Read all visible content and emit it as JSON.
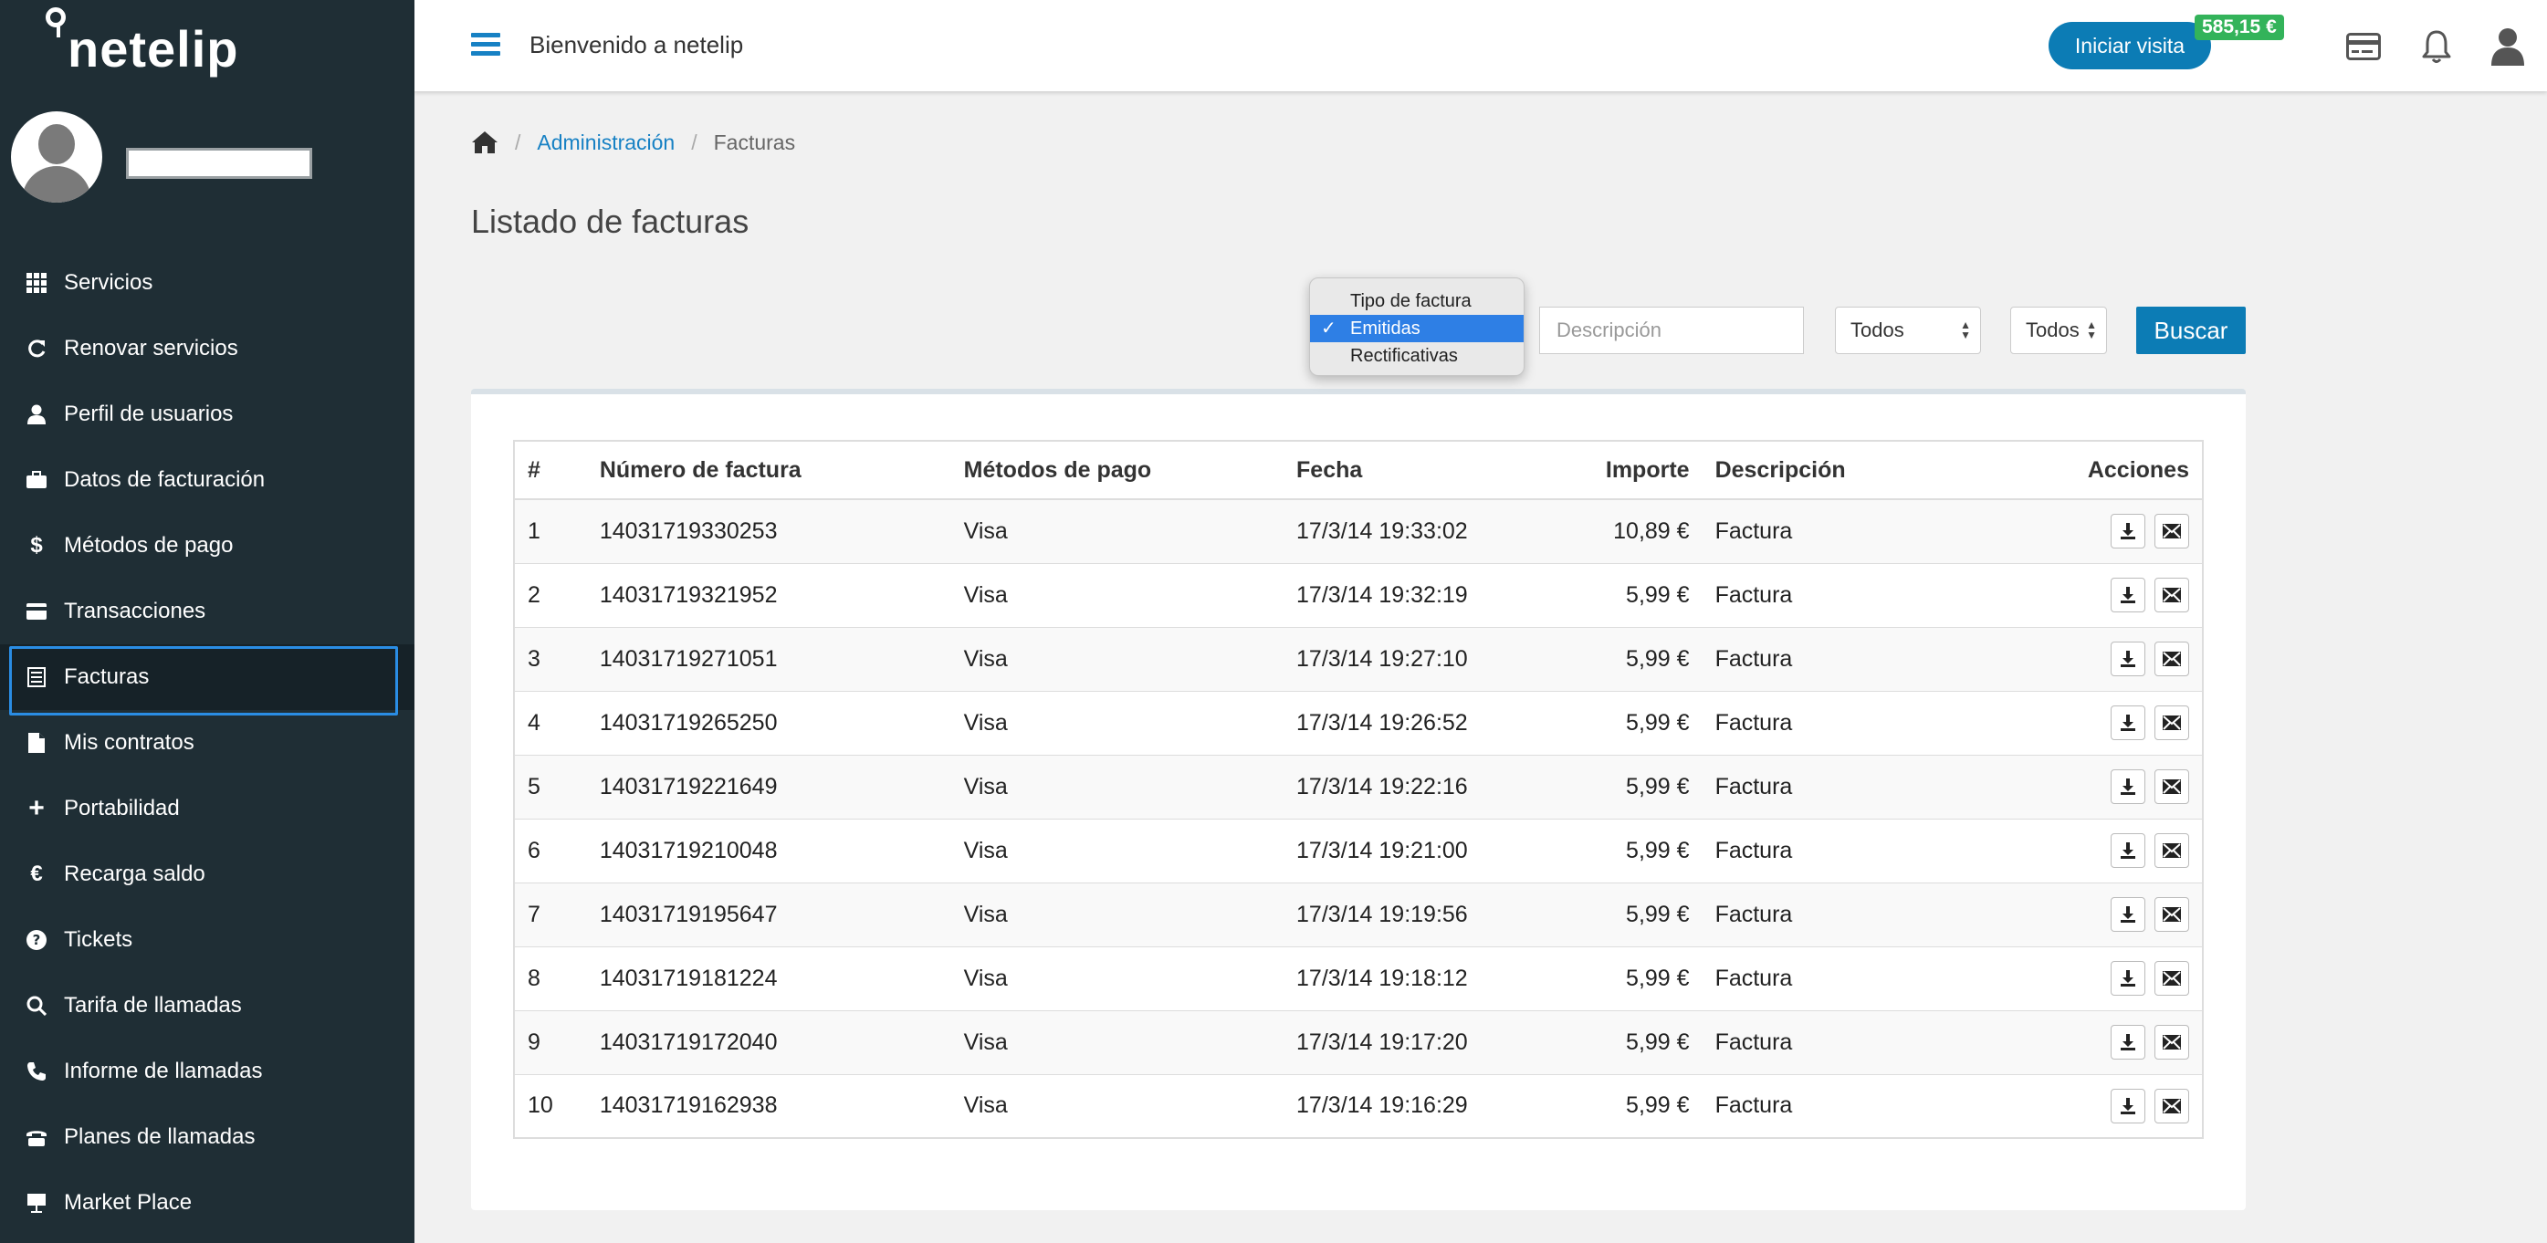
{
  "app": {
    "logo": "netelip"
  },
  "header": {
    "welcome": "Bienvenido a netelip",
    "visit_button": "Iniciar visita",
    "balance": "585,15 €"
  },
  "sidebar": {
    "items": [
      {
        "label": "Servicios",
        "icon": "grid-icon"
      },
      {
        "label": "Renovar servicios",
        "icon": "refresh-icon"
      },
      {
        "label": "Perfil de usuarios",
        "icon": "user-icon"
      },
      {
        "label": "Datos de facturación",
        "icon": "briefcase-icon"
      },
      {
        "label": "Métodos de pago",
        "icon": "dollar-icon"
      },
      {
        "label": "Transacciones",
        "icon": "credit-card-icon"
      },
      {
        "label": "Facturas",
        "icon": "invoice-icon",
        "active": true
      },
      {
        "label": "Mis contratos",
        "icon": "file-icon"
      },
      {
        "label": "Portabilidad",
        "icon": "plus-icon"
      },
      {
        "label": "Recarga saldo",
        "icon": "euro-icon"
      },
      {
        "label": "Tickets",
        "icon": "question-icon"
      },
      {
        "label": "Tarifa de llamadas",
        "icon": "search-icon"
      },
      {
        "label": "Informe de llamadas",
        "icon": "phone-icon"
      },
      {
        "label": "Planes de llamadas",
        "icon": "telephone-icon"
      },
      {
        "label": "Market Place",
        "icon": "easel-icon"
      }
    ]
  },
  "breadcrumb": {
    "level1": "Administración",
    "level2": "Facturas"
  },
  "page": {
    "title": "Listado de facturas"
  },
  "filters": {
    "type_options": [
      "Tipo de factura",
      "Emitidas",
      "Rectificativas"
    ],
    "type_selected": "Emitidas",
    "description_placeholder": "Descripción",
    "select1": "Todos",
    "select2": "Todos",
    "search_button": "Buscar"
  },
  "table": {
    "headers": [
      "#",
      "Número de factura",
      "Métodos de pago",
      "Fecha",
      "Importe",
      "Descripción",
      "Acciones"
    ],
    "rows": [
      [
        "1",
        "14031719330253",
        "Visa",
        "17/3/14 19:33:02",
        "10,89 €",
        "Factura"
      ],
      [
        "2",
        "14031719321952",
        "Visa",
        "17/3/14 19:32:19",
        "5,99 €",
        "Factura"
      ],
      [
        "3",
        "14031719271051",
        "Visa",
        "17/3/14 19:27:10",
        "5,99 €",
        "Factura"
      ],
      [
        "4",
        "14031719265250",
        "Visa",
        "17/3/14 19:26:52",
        "5,99 €",
        "Factura"
      ],
      [
        "5",
        "14031719221649",
        "Visa",
        "17/3/14 19:22:16",
        "5,99 €",
        "Factura"
      ],
      [
        "6",
        "14031719210048",
        "Visa",
        "17/3/14 19:21:00",
        "5,99 €",
        "Factura"
      ],
      [
        "7",
        "14031719195647",
        "Visa",
        "17/3/14 19:19:56",
        "5,99 €",
        "Factura"
      ],
      [
        "8",
        "14031719181224",
        "Visa",
        "17/3/14 19:18:12",
        "5,99 €",
        "Factura"
      ],
      [
        "9",
        "14031719172040",
        "Visa",
        "17/3/14 19:17:20",
        "5,99 €",
        "Factura"
      ],
      [
        "10",
        "14031719162938",
        "Visa",
        "17/3/14 19:16:29",
        "5,99 €",
        "Factura"
      ]
    ]
  },
  "colors": {
    "sidebar": "#1f2e35",
    "accent": "#0c7cb5",
    "balance": "#33b35a",
    "active_border": "#2a8de4"
  }
}
